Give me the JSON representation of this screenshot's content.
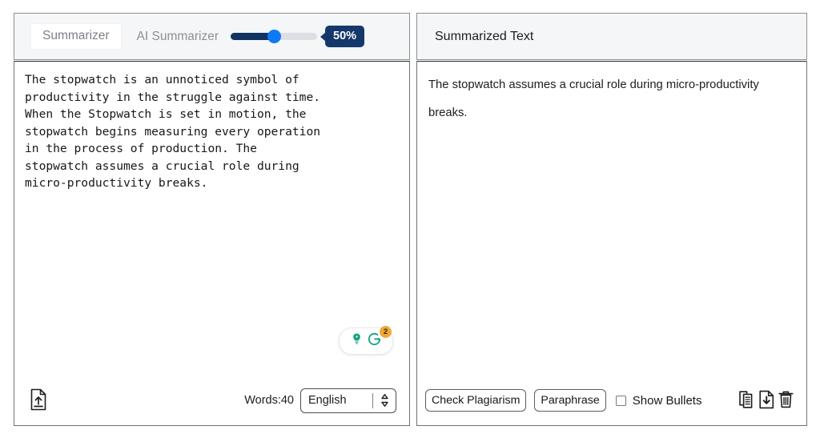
{
  "left_panel": {
    "tab_label": "Summarizer",
    "mode_label": "AI Summarizer",
    "slider": {
      "value_label": "50%",
      "value": 50,
      "min": 0,
      "max": 100,
      "fill_color": "#123462",
      "thumb_color": "#0d7bf7",
      "track_color": "#dcdfe3",
      "badge_color": "#14386c"
    },
    "source_text": "The stopwatch is an unnoticed symbol of\nproductivity in the struggle against time.\nWhen the Stopwatch is set in motion, the\nstopwatch begins measuring every operation\nin the process of production. The\nstopwatch assumes a crucial role during\nmicro-productivity breaks.",
    "assistant": {
      "lightbulb_icon": "lightbulb-idea-icon",
      "grammarly_icon": "grammarly-g-icon",
      "badge_count": "2",
      "badge_color": "#f0a73a",
      "brand_color": "#15a37f"
    },
    "footer": {
      "upload_icon": "upload-document-icon",
      "word_count_label": "Words:40",
      "language_value": "English",
      "language_options": [
        "English"
      ]
    }
  },
  "right_panel": {
    "title": "Summarized Text",
    "summary_text": "The stopwatch assumes a crucial role during micro-productivity breaks.",
    "footer": {
      "check_plagiarism_label": "Check Plagiarism",
      "paraphrase_label": "Paraphrase",
      "show_bullets_label": "Show Bullets",
      "show_bullets_checked": false,
      "copy_icon": "copy-documents-icon",
      "download_icon": "download-document-icon",
      "delete_icon": "trash-can-icon"
    }
  }
}
